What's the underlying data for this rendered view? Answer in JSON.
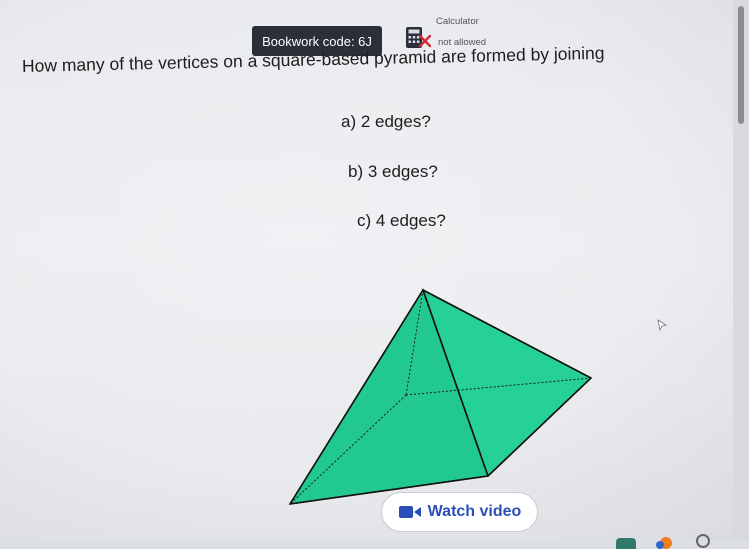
{
  "header": {
    "bookwork_code": "Bookwork code: 6J",
    "calculator_label": "Calculator",
    "calculator_status": "not allowed"
  },
  "question": {
    "text": "How many of the vertices on a square-based pyramid are formed by joining",
    "parts": [
      {
        "label": "a) 2 edges?"
      },
      {
        "label": "b) 3 edges?"
      },
      {
        "label": "c) 4 edges?"
      }
    ]
  },
  "figure": {
    "shape": "square-based pyramid",
    "fill_color": "#22c98f",
    "edge_color": "#111111"
  },
  "watch_video": {
    "label": "Watch video",
    "icon": "video-camera-icon",
    "color": "#2b4fb8"
  },
  "icons": {
    "calculator": "calculator-crossed-icon",
    "cursor": "mouse-pointer-icon"
  }
}
